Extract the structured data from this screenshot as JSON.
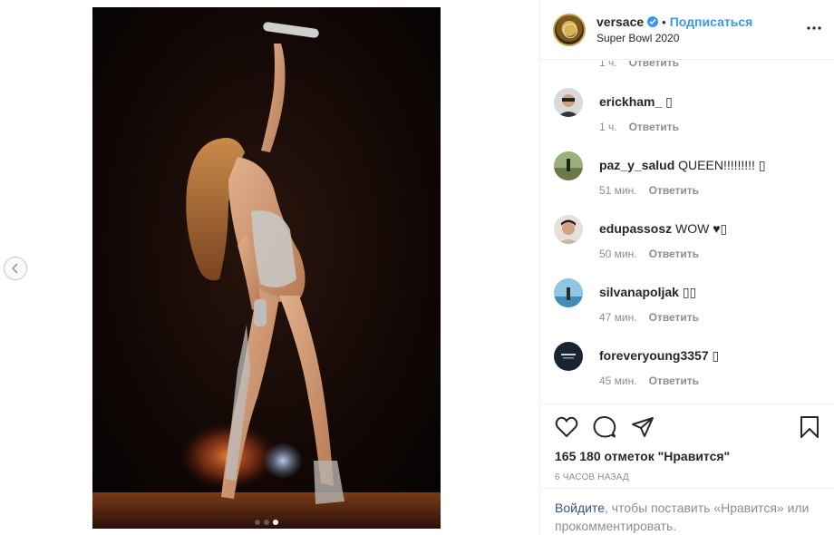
{
  "post": {
    "carousel": {
      "slide_count": 3,
      "active_index": 2
    }
  },
  "header": {
    "username": "versace",
    "separator": "•",
    "follow_label": "Подписаться",
    "location": "Super Bowl 2020",
    "more_icon": "more-horizontal-icon"
  },
  "comments": {
    "partial_meta": {
      "time": "1 ч.",
      "reply": "Ответить"
    },
    "items": [
      {
        "username": "erickham_",
        "text": "▯",
        "time": "1 ч.",
        "reply": "Ответить"
      },
      {
        "username": "paz_y_salud",
        "text": "QUEEN!!!!!!!!! ▯",
        "time": "51 мин.",
        "reply": "Ответить"
      },
      {
        "username": "edupassosz",
        "text": "WOW ♥▯",
        "time": "50 мин.",
        "reply": "Ответить"
      },
      {
        "username": "silvanapoljak",
        "text": "▯▯",
        "time": "47 мин.",
        "reply": "Ответить"
      },
      {
        "username": "foreveryoung3357",
        "text": "▯",
        "time": "45 мин.",
        "reply": "Ответить"
      }
    ]
  },
  "actions": {
    "icons": [
      "heart-icon",
      "comment-icon",
      "share-icon",
      "bookmark-icon"
    ],
    "likes": "165 180 отметок \"Нравится\"",
    "time_ago": "6 часов назад"
  },
  "login_prompt": {
    "link": "Войдите",
    "text": ", чтобы поставить «Нравится» или прокомментировать."
  },
  "colors": {
    "accent": "#3897f0",
    "text": "#262626",
    "muted": "#8e8e8e",
    "link": "#385185",
    "border": "#efefef"
  }
}
